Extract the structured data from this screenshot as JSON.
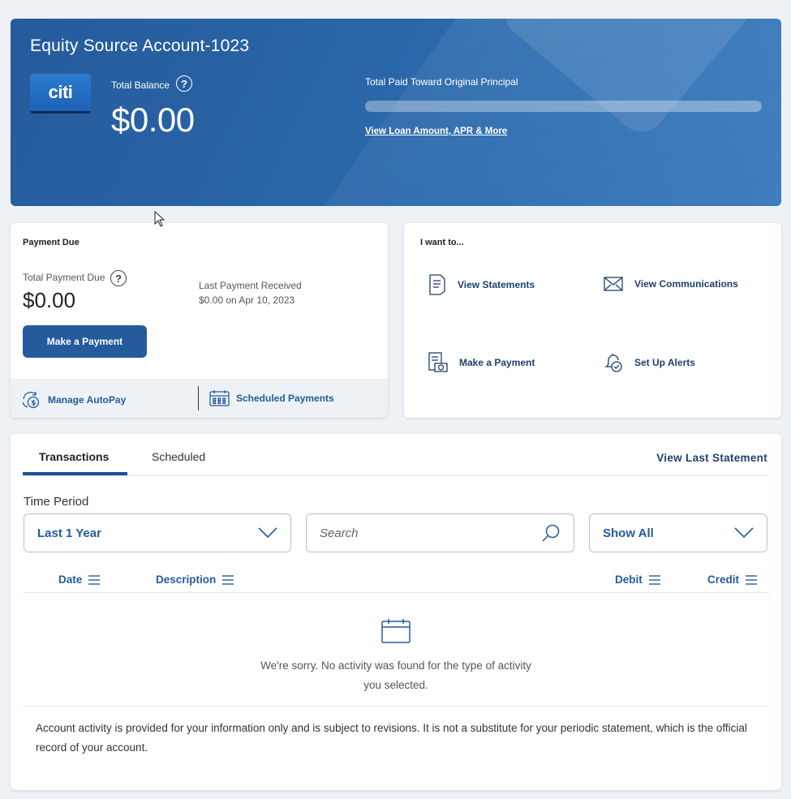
{
  "account": {
    "title": "Equity Source Account-1023",
    "logo_text": "citi",
    "total_balance_label": "Total Balance",
    "total_balance": "$0.00",
    "principal_label": "Total Paid Toward Original Principal",
    "principal_paid_fraction": 0,
    "loan_link": "View Loan Amount, APR & More",
    "help_glyph": "?"
  },
  "payment_due": {
    "heading": "Payment Due",
    "total_due_label": "Total Payment Due",
    "total_due": "$0.00",
    "last_payment_label": "Last Payment Received",
    "last_payment_value": "$0.00 on Apr 10, 2023",
    "make_payment_button": "Make a Payment",
    "manage_autopay": "Manage AutoPay",
    "scheduled_payments": "Scheduled Payments"
  },
  "i_want_to": {
    "heading": "I want to...",
    "items": [
      {
        "label": "View Statements",
        "icon": "document-icon"
      },
      {
        "label": "View Communications",
        "icon": "envelope-icon"
      },
      {
        "label": "Make a Payment",
        "icon": "bill-payment-icon"
      },
      {
        "label": "Set Up Alerts",
        "icon": "bell-check-icon"
      }
    ]
  },
  "transactions": {
    "tabs": [
      "Transactions",
      "Scheduled"
    ],
    "active_tab": "Transactions",
    "view_last_statement": "View Last Statement",
    "time_period_label": "Time Period",
    "time_period_value": "Last 1 Year",
    "search_placeholder": "Search",
    "filter_value": "Show All",
    "columns": [
      "Date",
      "Description",
      "Debit",
      "Credit"
    ],
    "empty_message": "We're sorry. No activity was found for the type of activity you selected.",
    "disclaimer": "Account activity is provided for your information only and is subject to revisions. It is not a substitute for your periodic statement, which is the official record of your account."
  },
  "colors": {
    "brand_blue": "#255b9c",
    "link_navy": "#1f3f6e",
    "page_bg": "#eef1f5"
  }
}
